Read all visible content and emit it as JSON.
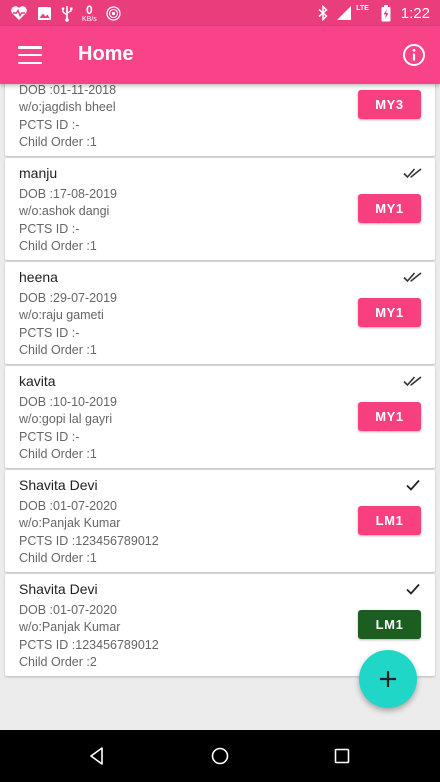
{
  "status_bar": {
    "net_speed_value": "0",
    "net_speed_unit": "KB/s",
    "network_label": "LTE",
    "time": "1:22"
  },
  "app_bar": {
    "title": "Home"
  },
  "list": [
    {
      "name": "",
      "dob": "DOB :01-11-2018",
      "wo": "w/o:jagdish bheel",
      "pcts": "PCTS ID :-",
      "child_order": "Child Order :1",
      "button": "MY3",
      "button_color": "#f83f7f",
      "check": "none"
    },
    {
      "name": "manju",
      "dob": "DOB :17-08-2019",
      "wo": "w/o:ashok dangi",
      "pcts": "PCTS ID :-",
      "child_order": "Child Order :1",
      "button": "MY1",
      "button_color": "#f83f7f",
      "check": "double-check-icon"
    },
    {
      "name": "heena",
      "dob": "DOB :29-07-2019",
      "wo": "w/o:raju gameti",
      "pcts": "PCTS ID :-",
      "child_order": "Child Order :1",
      "button": "MY1",
      "button_color": "#f83f7f",
      "check": "double-check-icon"
    },
    {
      "name": "kavita",
      "dob": "DOB :10-10-2019",
      "wo": "w/o:gopi lal gayri",
      "pcts": "PCTS ID :-",
      "child_order": "Child Order :1",
      "button": "MY1",
      "button_color": "#f83f7f",
      "check": "double-check-icon"
    },
    {
      "name": "Shavita Devi",
      "dob": "DOB :01-07-2020",
      "wo": "w/o:Panjak Kumar",
      "pcts": "PCTS ID :123456789012",
      "child_order": "Child Order :1",
      "button": "LM1",
      "button_color": "#f83f7f",
      "check": "check-icon"
    },
    {
      "name": "Shavita Devi",
      "dob": "DOB :01-07-2020",
      "wo": "w/o:Panjak Kumar",
      "pcts": "PCTS ID :123456789012",
      "child_order": "Child Order :2",
      "button": "LM1",
      "button_color": "#1b5e20",
      "check": "check-icon"
    }
  ],
  "colors": {
    "status_bar": "#ea3d7c",
    "app_bar": "#f84388",
    "fab": "#20d6c6"
  },
  "icons": {
    "menu": "menu-icon",
    "info": "info-icon",
    "fab": "plus-icon",
    "nav": [
      "back-icon",
      "home-icon",
      "recents-icon"
    ]
  }
}
